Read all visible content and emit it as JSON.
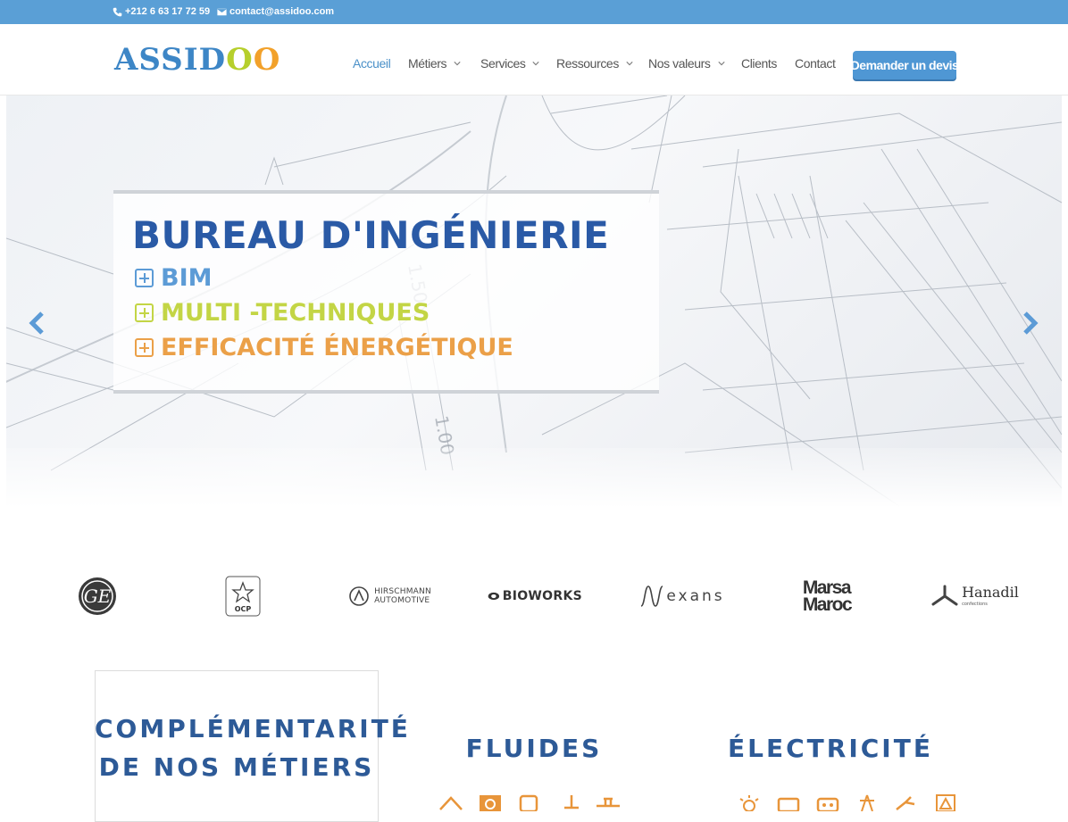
{
  "topbar": {
    "phone": "+212 6 63 17 72 59",
    "email": "contact@assidoo.com",
    "color": "#5a9fd6"
  },
  "header": {
    "logo_text": "ASSIDOO",
    "nav": [
      {
        "label": "Accueil",
        "active": true,
        "dropdown": false
      },
      {
        "label": "Métiers",
        "active": false,
        "dropdown": true
      },
      {
        "label": "Services",
        "active": false,
        "dropdown": true
      },
      {
        "label": "Ressources",
        "active": false,
        "dropdown": true
      },
      {
        "label": "Nos valeurs",
        "active": false,
        "dropdown": true
      },
      {
        "label": "Clients",
        "active": false,
        "dropdown": false
      },
      {
        "label": "Contact",
        "active": false,
        "dropdown": false
      }
    ],
    "cta_label": "Demander un devis"
  },
  "hero": {
    "title": "BUREAU D'INGÉNIERIE",
    "lines": [
      {
        "label": "BIM",
        "color": "#5c9bd6"
      },
      {
        "label": "MULTI -TECHNIQUES",
        "color": "#c3d545"
      },
      {
        "label": "EFFICACITÉ ÉNERGÉTIQUE",
        "color": "#eba048"
      }
    ],
    "prev_icon": "chevron-left-icon",
    "next_icon": "chevron-right-icon"
  },
  "clients": [
    {
      "name": "GE",
      "icon": "ge-logo"
    },
    {
      "name": "OCP",
      "icon": "ocp-logo"
    },
    {
      "name": "HIRSCHMANN AUTOMOTIVE",
      "line1": "HIRSCHMANN",
      "line2": "AUTOMOTIVE"
    },
    {
      "name": "BIOWORKS"
    },
    {
      "name": "exans",
      "icon": "nexans-logo"
    },
    {
      "name": "Marsa Maroc",
      "line1": "Marsa",
      "line2": "Maroc"
    },
    {
      "name": "Hanadil",
      "sub": "confections"
    }
  ],
  "sections": {
    "complementarite_line1": "COMPLÉMENTARITÉ",
    "complementarite_line2": "DE NOS MÉTIERS",
    "fluides": "FLUIDES",
    "electricite": "ÉLECTRICITÉ",
    "icon_color": "#e8953a"
  }
}
